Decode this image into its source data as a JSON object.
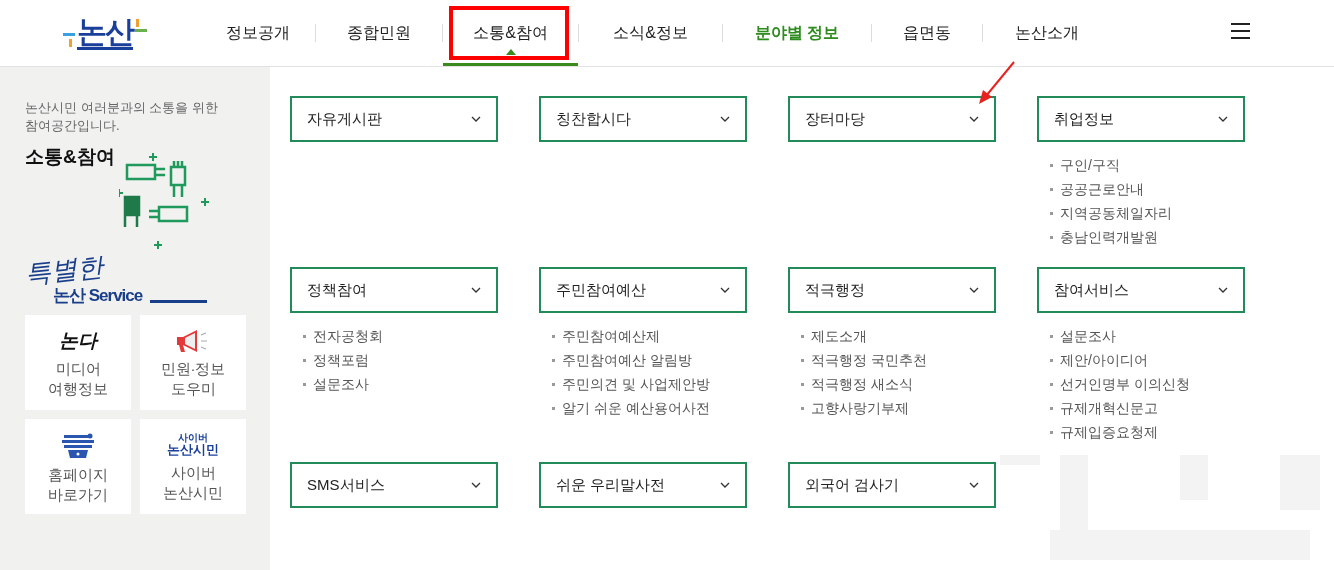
{
  "logo": "논산",
  "nav": [
    {
      "label": "정보공개",
      "selected": false,
      "emphasized": false
    },
    {
      "label": "종합민원",
      "selected": false,
      "emphasized": false
    },
    {
      "label": "소통&참여",
      "selected": true,
      "emphasized": false
    },
    {
      "label": "소식&정보",
      "selected": false,
      "emphasized": false
    },
    {
      "label": "분야별 정보",
      "selected": false,
      "emphasized": true
    },
    {
      "label": "읍면동",
      "selected": false,
      "emphasized": false
    },
    {
      "label": "논산소개",
      "selected": false,
      "emphasized": false
    }
  ],
  "sidebar": {
    "intro": "논산시민 여러분과의 소통을 위한 참여공간입니다.",
    "title": "소통&참여",
    "special_script": "특별한",
    "special_title": "논산 Service",
    "quick_links": [
      {
        "kind": "text_logo",
        "logo_lines": [
          "논다"
        ],
        "label": "미디어\n여행정보"
      },
      {
        "kind": "megaphone",
        "label": "민원·정보\n도우미"
      },
      {
        "kind": "badge",
        "label": "홈페이지\n바로가기"
      },
      {
        "kind": "text_logo",
        "logo_lines": [
          "사이버",
          "논산시민"
        ],
        "label": "사이버\n논산시민"
      }
    ]
  },
  "menu_rows": [
    [
      {
        "title": "자유게시판"
      },
      {
        "title": "칭찬합시다"
      },
      {
        "title": "장터마당"
      },
      {
        "title": "취업정보",
        "links": [
          "구인/구직",
          "공공근로안내",
          "지역공동체일자리",
          "충남인력개발원"
        ]
      }
    ],
    [
      {
        "title": "정책참여",
        "links": [
          "전자공청회",
          "정책포럼",
          "설문조사"
        ]
      },
      {
        "title": "주민참여예산",
        "links": [
          "주민참여예산제",
          "주민참여예산 알림방",
          "주민의견 및 사업제안방",
          "알기 쉬운 예산용어사전"
        ]
      },
      {
        "title": "적극행정",
        "links": [
          "제도소개",
          "적극행정 국민추천",
          "적극행정 새소식",
          "고향사랑기부제"
        ]
      },
      {
        "title": "참여서비스",
        "links": [
          "설문조사",
          "제안/아이디어",
          "선거인명부 이의신청",
          "규제개혁신문고",
          "규제입증요청제"
        ]
      }
    ],
    [
      {
        "title": "SMS서비스"
      },
      {
        "title": "쉬운 우리말사전"
      },
      {
        "title": "외국어 검사기"
      }
    ]
  ]
}
